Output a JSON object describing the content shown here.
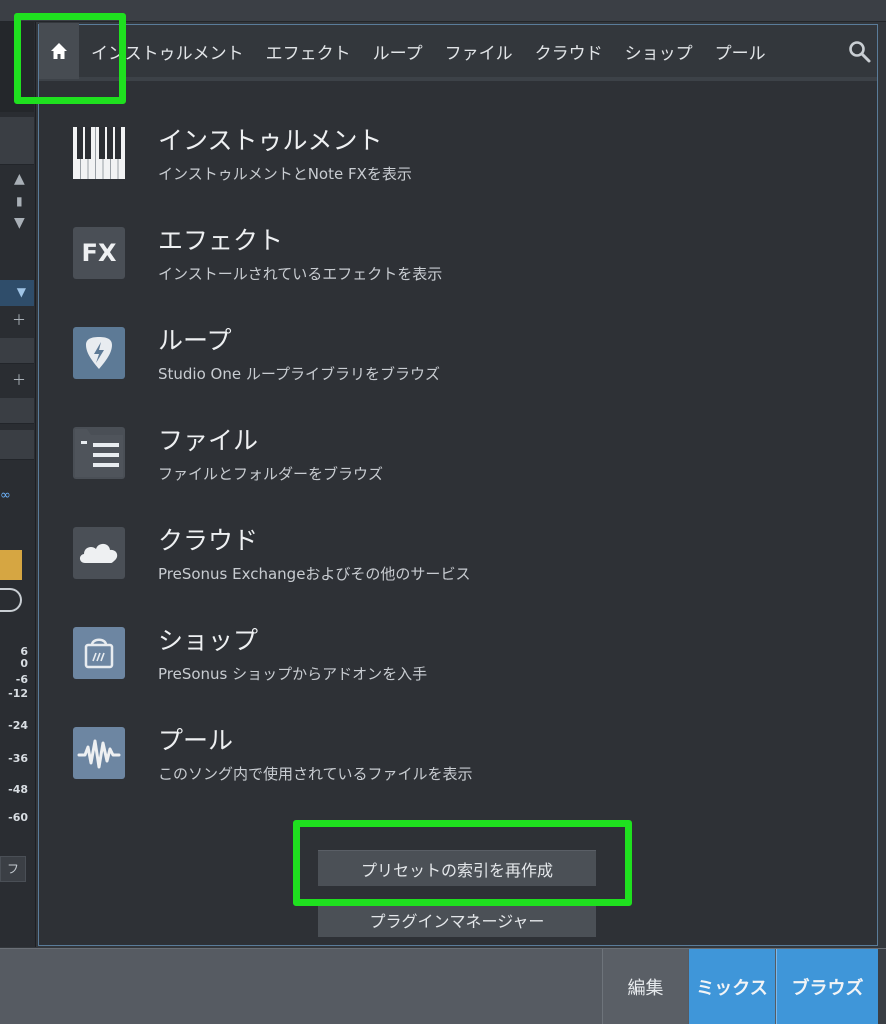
{
  "nav": {
    "tabs": [
      "インストゥルメント",
      "エフェクト",
      "ループ",
      "ファイル",
      "クラウド",
      "ショップ",
      "プール"
    ]
  },
  "items": [
    {
      "title": "インストゥルメント",
      "desc": "インストゥルメントとNote FXを表示",
      "icon": "piano-keys-icon"
    },
    {
      "title": "エフェクト",
      "desc": "インストールされているエフェクトを表示",
      "icon": "fx-icon"
    },
    {
      "title": "ループ",
      "desc": "Studio One ループライブラリをブラウズ",
      "icon": "guitar-pick-icon"
    },
    {
      "title": "ファイル",
      "desc": "ファイルとフォルダーをブラウズ",
      "icon": "folder-list-icon"
    },
    {
      "title": "クラウド",
      "desc": "PreSonus Exchangeおよびその他のサービス",
      "icon": "cloud-icon"
    },
    {
      "title": "ショップ",
      "desc": "PreSonus ショップからアドオンを入手",
      "icon": "shopping-bag-icon"
    },
    {
      "title": "プール",
      "desc": "このソング内で使用されているファイルを表示",
      "icon": "waveform-icon"
    }
  ],
  "fx_icon_text": "FX",
  "buttons": {
    "rebuild_index": "プリセットの索引を再作成",
    "plugin_manager": "プラグインマネージャー"
  },
  "bottom_bar": {
    "edit": "編集",
    "mix": "ミックス",
    "browse": "ブラウズ"
  },
  "meter_scale": [
    "6",
    "0",
    "-6",
    "-12",
    "-24",
    "-36",
    "-48",
    "-60"
  ],
  "left_panel_fragment": "フ",
  "colors": {
    "accent_blue": "#3f96d9",
    "highlight_green": "#1fe01f",
    "panel_bg": "#2e3136"
  }
}
